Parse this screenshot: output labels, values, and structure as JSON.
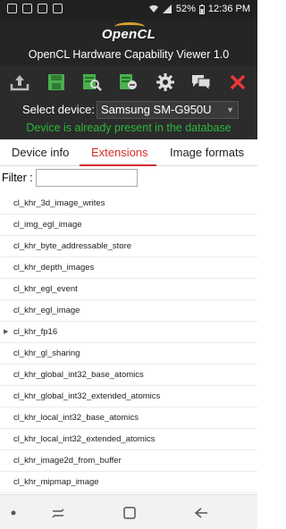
{
  "status_bar": {
    "battery": "52%",
    "time": "12:36 PM"
  },
  "header": {
    "logo_text": "OpenCL",
    "app_title": "OpenCL Hardware Capability Viewer 1.0"
  },
  "toolbar": {
    "buttons": [
      {
        "name": "upload-icon"
      },
      {
        "name": "save-icon"
      },
      {
        "name": "compare-report-icon"
      },
      {
        "name": "database-report-icon"
      },
      {
        "name": "settings-gear-icon"
      },
      {
        "name": "chat-icon"
      },
      {
        "name": "close-icon"
      }
    ],
    "accent_green": "#4caf50",
    "close_red": "#e53935"
  },
  "device": {
    "label": "Select device:",
    "selected": "Samsung SM-G950U",
    "note": "Device is already present in the database",
    "note_color": "#2db83d"
  },
  "tabs": [
    {
      "label": "Device info"
    },
    {
      "label": "Extensions"
    },
    {
      "label": "Image formats"
    }
  ],
  "active_tab": "Extensions",
  "filter": {
    "label": "Filter :",
    "value": ""
  },
  "extensions": [
    {
      "name": "cl_khr_3d_image_writes",
      "expandable": false
    },
    {
      "name": "cl_img_egl_image",
      "expandable": false
    },
    {
      "name": "cl_khr_byte_addressable_store",
      "expandable": false
    },
    {
      "name": "cl_khr_depth_images",
      "expandable": false
    },
    {
      "name": "cl_khr_egl_event",
      "expandable": false
    },
    {
      "name": "cl_khr_egl_image",
      "expandable": false
    },
    {
      "name": "cl_khr_fp16",
      "expandable": true
    },
    {
      "name": "cl_khr_gl_sharing",
      "expandable": false
    },
    {
      "name": "cl_khr_global_int32_base_atomics",
      "expandable": false
    },
    {
      "name": "cl_khr_global_int32_extended_atomics",
      "expandable": false
    },
    {
      "name": "cl_khr_local_int32_base_atomics",
      "expandable": false
    },
    {
      "name": "cl_khr_local_int32_extended_atomics",
      "expandable": false
    },
    {
      "name": "cl_khr_image2d_from_buffer",
      "expandable": false
    },
    {
      "name": "cl_khr_mipmap_image",
      "expandable": false
    }
  ],
  "nav_bar": {
    "buttons": [
      "dot-icon",
      "recents-icon",
      "home-icon",
      "back-icon"
    ]
  }
}
